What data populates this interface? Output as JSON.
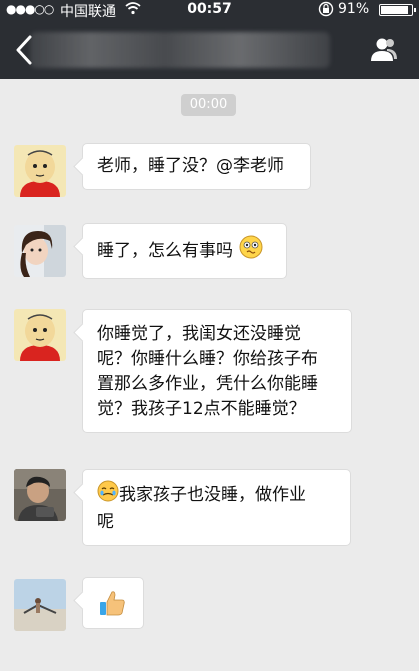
{
  "status_bar": {
    "signal": "●●●○○",
    "carrier": "中国联通",
    "time": "00:57",
    "battery_text": "91%",
    "battery_level": 0.91
  },
  "nav": {
    "back_icon": "chevron-left-icon",
    "profile_icon": "person-icon"
  },
  "chat": {
    "timestamp": "00:00",
    "messages": [
      {
        "avatar": "cartoon-red-shirt",
        "text": "老师，睡了没？@李老师"
      },
      {
        "avatar": "girl-photo",
        "text": "睡了，怎么有事吗",
        "trailing_emoji": "confused-face-icon"
      },
      {
        "avatar": "cartoon-red-shirt",
        "lines": [
          "你睡觉了，我闺女还没睡觉",
          "呢？你睡什么睡？你给孩子布",
          "置那么多作业，凭什么你能睡",
          "觉？我孩子12点不能睡觉？"
        ]
      },
      {
        "avatar": "man-photo",
        "leading_emoji": "crying-face-icon",
        "lines": [
          "我家孩子也没睡，做作业",
          "呢"
        ]
      },
      {
        "avatar": "landscape-photo",
        "emoji": "thumbs-up-icon"
      }
    ]
  },
  "colors": {
    "bar_bg": "#2b2e33",
    "chat_bg": "#ebebeb",
    "bubble_bg": "#ffffff",
    "timestamp_bg": "#cfcfcf"
  }
}
